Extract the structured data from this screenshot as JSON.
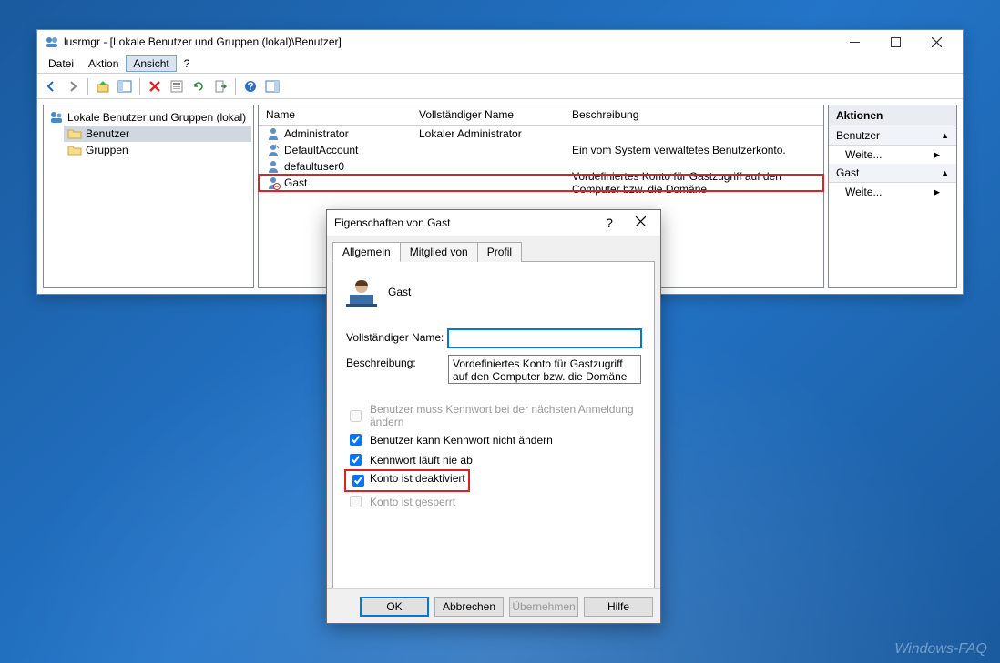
{
  "watermark": "Windows-FAQ",
  "mmc": {
    "title": "lusrmgr - [Lokale Benutzer und Gruppen (lokal)\\Benutzer]",
    "menu": {
      "file": "Datei",
      "action": "Aktion",
      "view": "Ansicht",
      "help": "?"
    },
    "tree": {
      "root": "Lokale Benutzer und Gruppen (lokal)",
      "users": "Benutzer",
      "groups": "Gruppen"
    },
    "columns": {
      "name": "Name",
      "fullname": "Vollständiger Name",
      "desc": "Beschreibung"
    },
    "rows": [
      {
        "name": "Administrator",
        "fullname": "Lokaler Administrator",
        "desc": ""
      },
      {
        "name": "DefaultAccount",
        "fullname": "",
        "desc": "Ein vom System verwaltetes Benutzerkonto."
      },
      {
        "name": "defaultuser0",
        "fullname": "",
        "desc": ""
      },
      {
        "name": "Gast",
        "fullname": "",
        "desc": "Vordefiniertes Konto für Gastzugriff auf den Computer bzw. die Domäne"
      }
    ],
    "actions": {
      "header": "Aktionen",
      "sec1": "Benutzer",
      "more1": "Weite...",
      "sec2": "Gast",
      "more2": "Weite..."
    }
  },
  "dlg": {
    "title": "Eigenschaften von Gast",
    "tabs": {
      "general": "Allgemein",
      "memberof": "Mitglied von",
      "profile": "Profil"
    },
    "account": "Gast",
    "labels": {
      "fullname": "Vollständiger Name:",
      "desc": "Beschreibung:"
    },
    "fullname_value": "",
    "desc_value": "Vordefiniertes Konto für Gastzugriff auf den Computer bzw. die Domäne",
    "checks": {
      "mustchange": "Benutzer muss Kennwort bei der nächsten Anmeldung ändern",
      "cannotchange": "Benutzer kann Kennwort nicht ändern",
      "neverexpires": "Kennwort läuft nie ab",
      "disabled": "Konto ist deaktiviert",
      "locked": "Konto ist gesperrt"
    },
    "buttons": {
      "ok": "OK",
      "cancel": "Abbrechen",
      "apply": "Übernehmen",
      "help": "Hilfe"
    }
  }
}
